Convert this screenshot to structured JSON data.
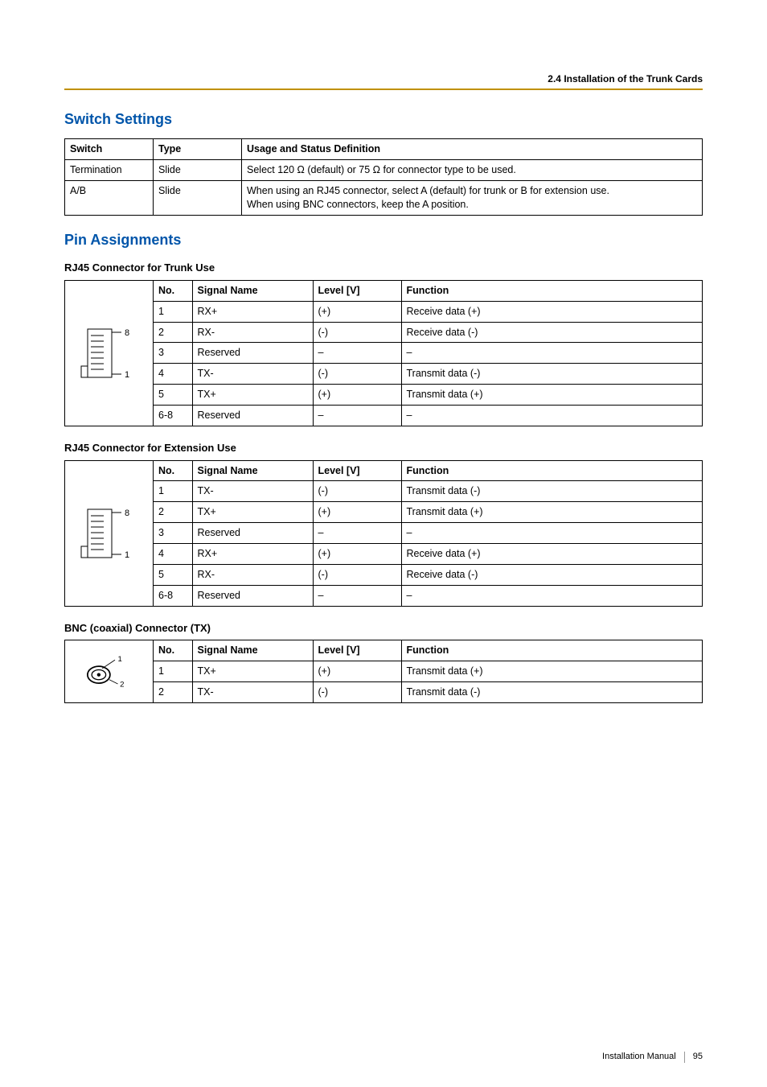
{
  "header": {
    "section": "2.4 Installation of the Trunk Cards"
  },
  "switch_settings": {
    "title": "Switch Settings",
    "headers": {
      "switch": "Switch",
      "type": "Type",
      "usage": "Usage and Status Definition"
    },
    "rows": [
      {
        "switch": "Termination",
        "type": "Slide",
        "usage": "Select 120 Ω (default) or 75 Ω for connector type to be used."
      },
      {
        "switch": "A/B",
        "type": "Slide",
        "usage": "When using an RJ45 connector, select A (default) for trunk or B for extension use.\nWhen using BNC connectors, keep the A position."
      }
    ]
  },
  "pin_assignments": {
    "title": "Pin Assignments",
    "table_headers": {
      "no": "No.",
      "signal": "Signal Name",
      "level": "Level [V]",
      "function": "Function"
    },
    "trunk": {
      "title": "RJ45 Connector for Trunk Use",
      "labels": {
        "top": "8",
        "bottom": "1"
      },
      "rows": [
        {
          "no": "1",
          "signal": "RX+",
          "level": "(+)",
          "function": "Receive data (+)"
        },
        {
          "no": "2",
          "signal": "RX-",
          "level": "(-)",
          "function": "Receive data (-)"
        },
        {
          "no": "3",
          "signal": "Reserved",
          "level": "–",
          "function": "–"
        },
        {
          "no": "4",
          "signal": "TX-",
          "level": "(-)",
          "function": "Transmit data (-)"
        },
        {
          "no": "5",
          "signal": "TX+",
          "level": "(+)",
          "function": "Transmit data (+)"
        },
        {
          "no": "6-8",
          "signal": "Reserved",
          "level": "–",
          "function": "–"
        }
      ]
    },
    "ext": {
      "title": "RJ45 Connector for Extension Use",
      "labels": {
        "top": "8",
        "bottom": "1"
      },
      "rows": [
        {
          "no": "1",
          "signal": "TX-",
          "level": "(-)",
          "function": "Transmit data (-)"
        },
        {
          "no": "2",
          "signal": "TX+",
          "level": "(+)",
          "function": "Transmit data (+)"
        },
        {
          "no": "3",
          "signal": "Reserved",
          "level": "–",
          "function": "–"
        },
        {
          "no": "4",
          "signal": "RX+",
          "level": "(+)",
          "function": "Receive data (+)"
        },
        {
          "no": "5",
          "signal": "RX-",
          "level": "(-)",
          "function": "Receive data (-)"
        },
        {
          "no": "6-8",
          "signal": "Reserved",
          "level": "–",
          "function": "–"
        }
      ]
    },
    "bnc": {
      "title": "BNC (coaxial) Connector (TX)",
      "labels": {
        "one": "1",
        "two": "2"
      },
      "rows": [
        {
          "no": "1",
          "signal": "TX+",
          "level": "(+)",
          "function": "Transmit data (+)"
        },
        {
          "no": "2",
          "signal": "TX-",
          "level": "(-)",
          "function": "Transmit data (-)"
        }
      ]
    }
  },
  "footer": {
    "doc": "Installation Manual",
    "page": "95"
  }
}
